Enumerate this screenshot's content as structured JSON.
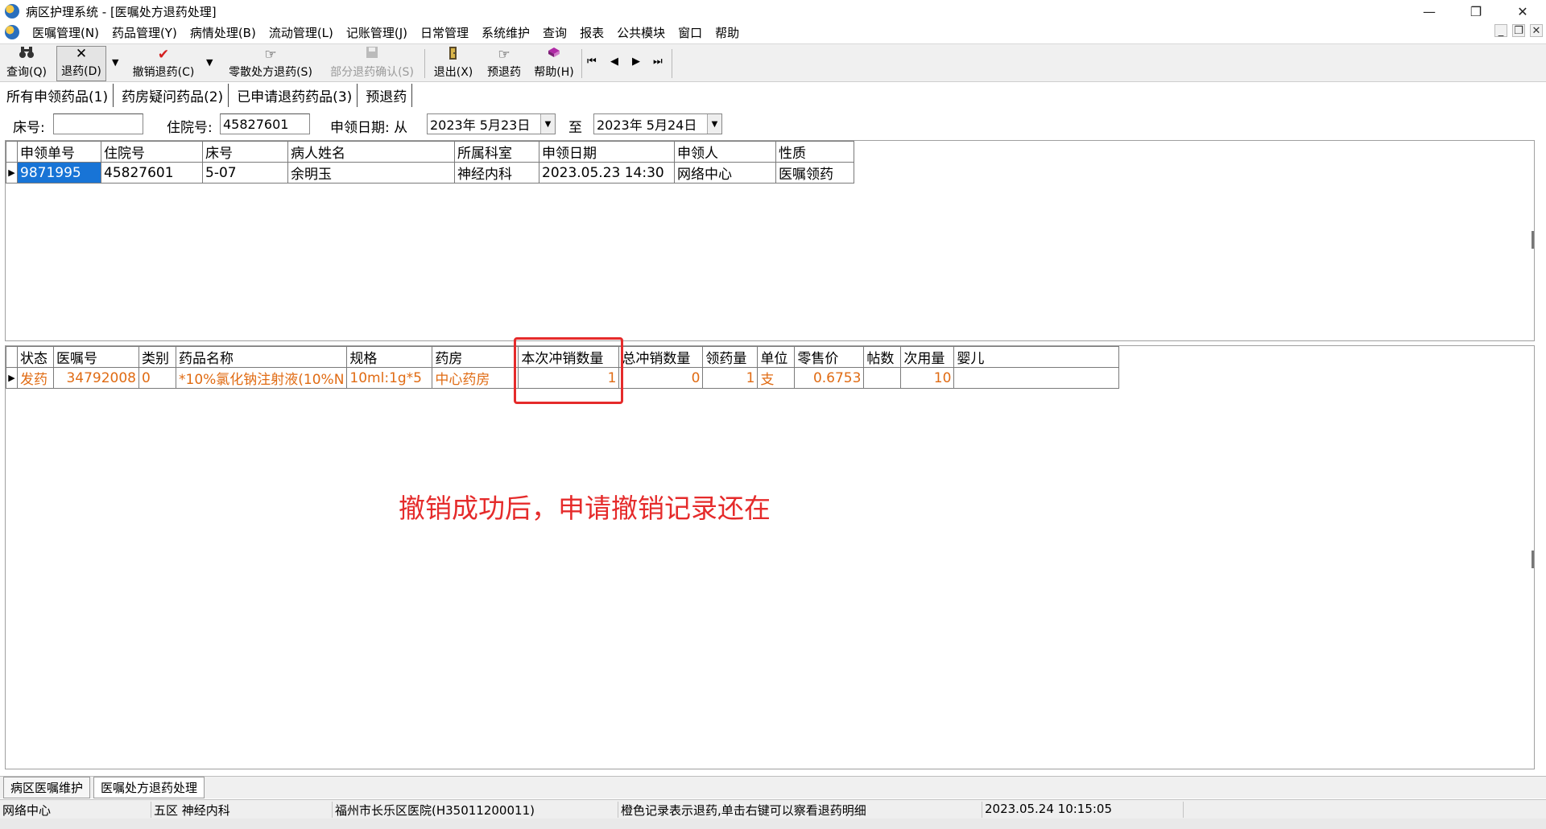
{
  "window": {
    "title": "病区护理系统 - [医嘱处方退药处理]",
    "minimize_glyph": "—",
    "restore_glyph": "❐",
    "close_glyph": "✕"
  },
  "menu": {
    "items": [
      "医嘱管理(N)",
      "药品管理(Y)",
      "病情处理(B)",
      "流动管理(L)",
      "记账管理(J)",
      "日常管理",
      "系统维护",
      "查询",
      "报表",
      "公共模块",
      "窗口",
      "帮助"
    ],
    "mdi_min": "_",
    "mdi_restore": "❐",
    "mdi_close": "✕"
  },
  "toolbar": {
    "query": "查询(Q)",
    "return_drug": "退药(D)",
    "cancel_return": "撤销退药(C)",
    "scatter_return": "零散处方退药(S)",
    "partial_confirm": "部分退药确认(S)",
    "exit": "退出(X)",
    "pre_return": "预退药",
    "help": "帮助(H)",
    "icons": {
      "query": "binoculars-icon",
      "return_drug": "x-icon",
      "cancel_return": "check-icon",
      "scatter_return": "hand-icon",
      "partial_confirm": "save-icon",
      "exit": "exit-door-icon",
      "pre_return": "hand-pointing-icon",
      "help": "help-book-icon"
    }
  },
  "tabs": [
    "所有申领药品(1)",
    "药房疑问药品(2)",
    "已申请退药药品(3)",
    "预退药"
  ],
  "filter": {
    "bed_label": "床号:",
    "bed_value": "",
    "hosp_label": "住院号:",
    "hosp_value": "45827601",
    "date_label": "申领日期: 从",
    "date_from": "2023年 5月23日",
    "to_label": "至",
    "date_to": "2023年 5月24日"
  },
  "top_grid": {
    "columns": [
      "申领单号",
      "住院号",
      "床号",
      "病人姓名",
      "所属科室",
      "申领日期",
      "申领人",
      "性质"
    ],
    "rows": [
      [
        "9871995",
        "45827601",
        "5-07",
        "余明玉",
        "神经内科",
        "2023.05.23 14:30",
        "网络中心",
        "医嘱领药"
      ]
    ]
  },
  "bottom_grid": {
    "columns": [
      "状态",
      "医嘱号",
      "类别",
      "药品名称",
      "规格",
      "药房",
      "本次冲销数量",
      "总冲销数量",
      "领药量",
      "单位",
      "零售价",
      "帖数",
      "次用量",
      "婴儿"
    ],
    "rows": [
      [
        "发药",
        "34792008",
        "0",
        "*10%氯化钠注射液(10%N",
        "10ml:1g*5",
        "中心药房",
        "1",
        "0",
        "1",
        "支",
        "0.6753",
        "",
        "10",
        ""
      ]
    ]
  },
  "annotation": "撤销成功后，申请撤销记录还在",
  "bottom_tabs": [
    "病区医嘱维护",
    "医嘱处方退药处理"
  ],
  "status": [
    "网络中心",
    "五区 神经内科",
    "福州市长乐区医院(H35011200011)",
    "橙色记录表示退药,单击右键可以察看退药明细",
    "2023.05.24 10:15:05"
  ],
  "colors": {
    "selection": "#1874d6",
    "returned_row": "#e06b13",
    "annotation": "#e52b2b"
  }
}
